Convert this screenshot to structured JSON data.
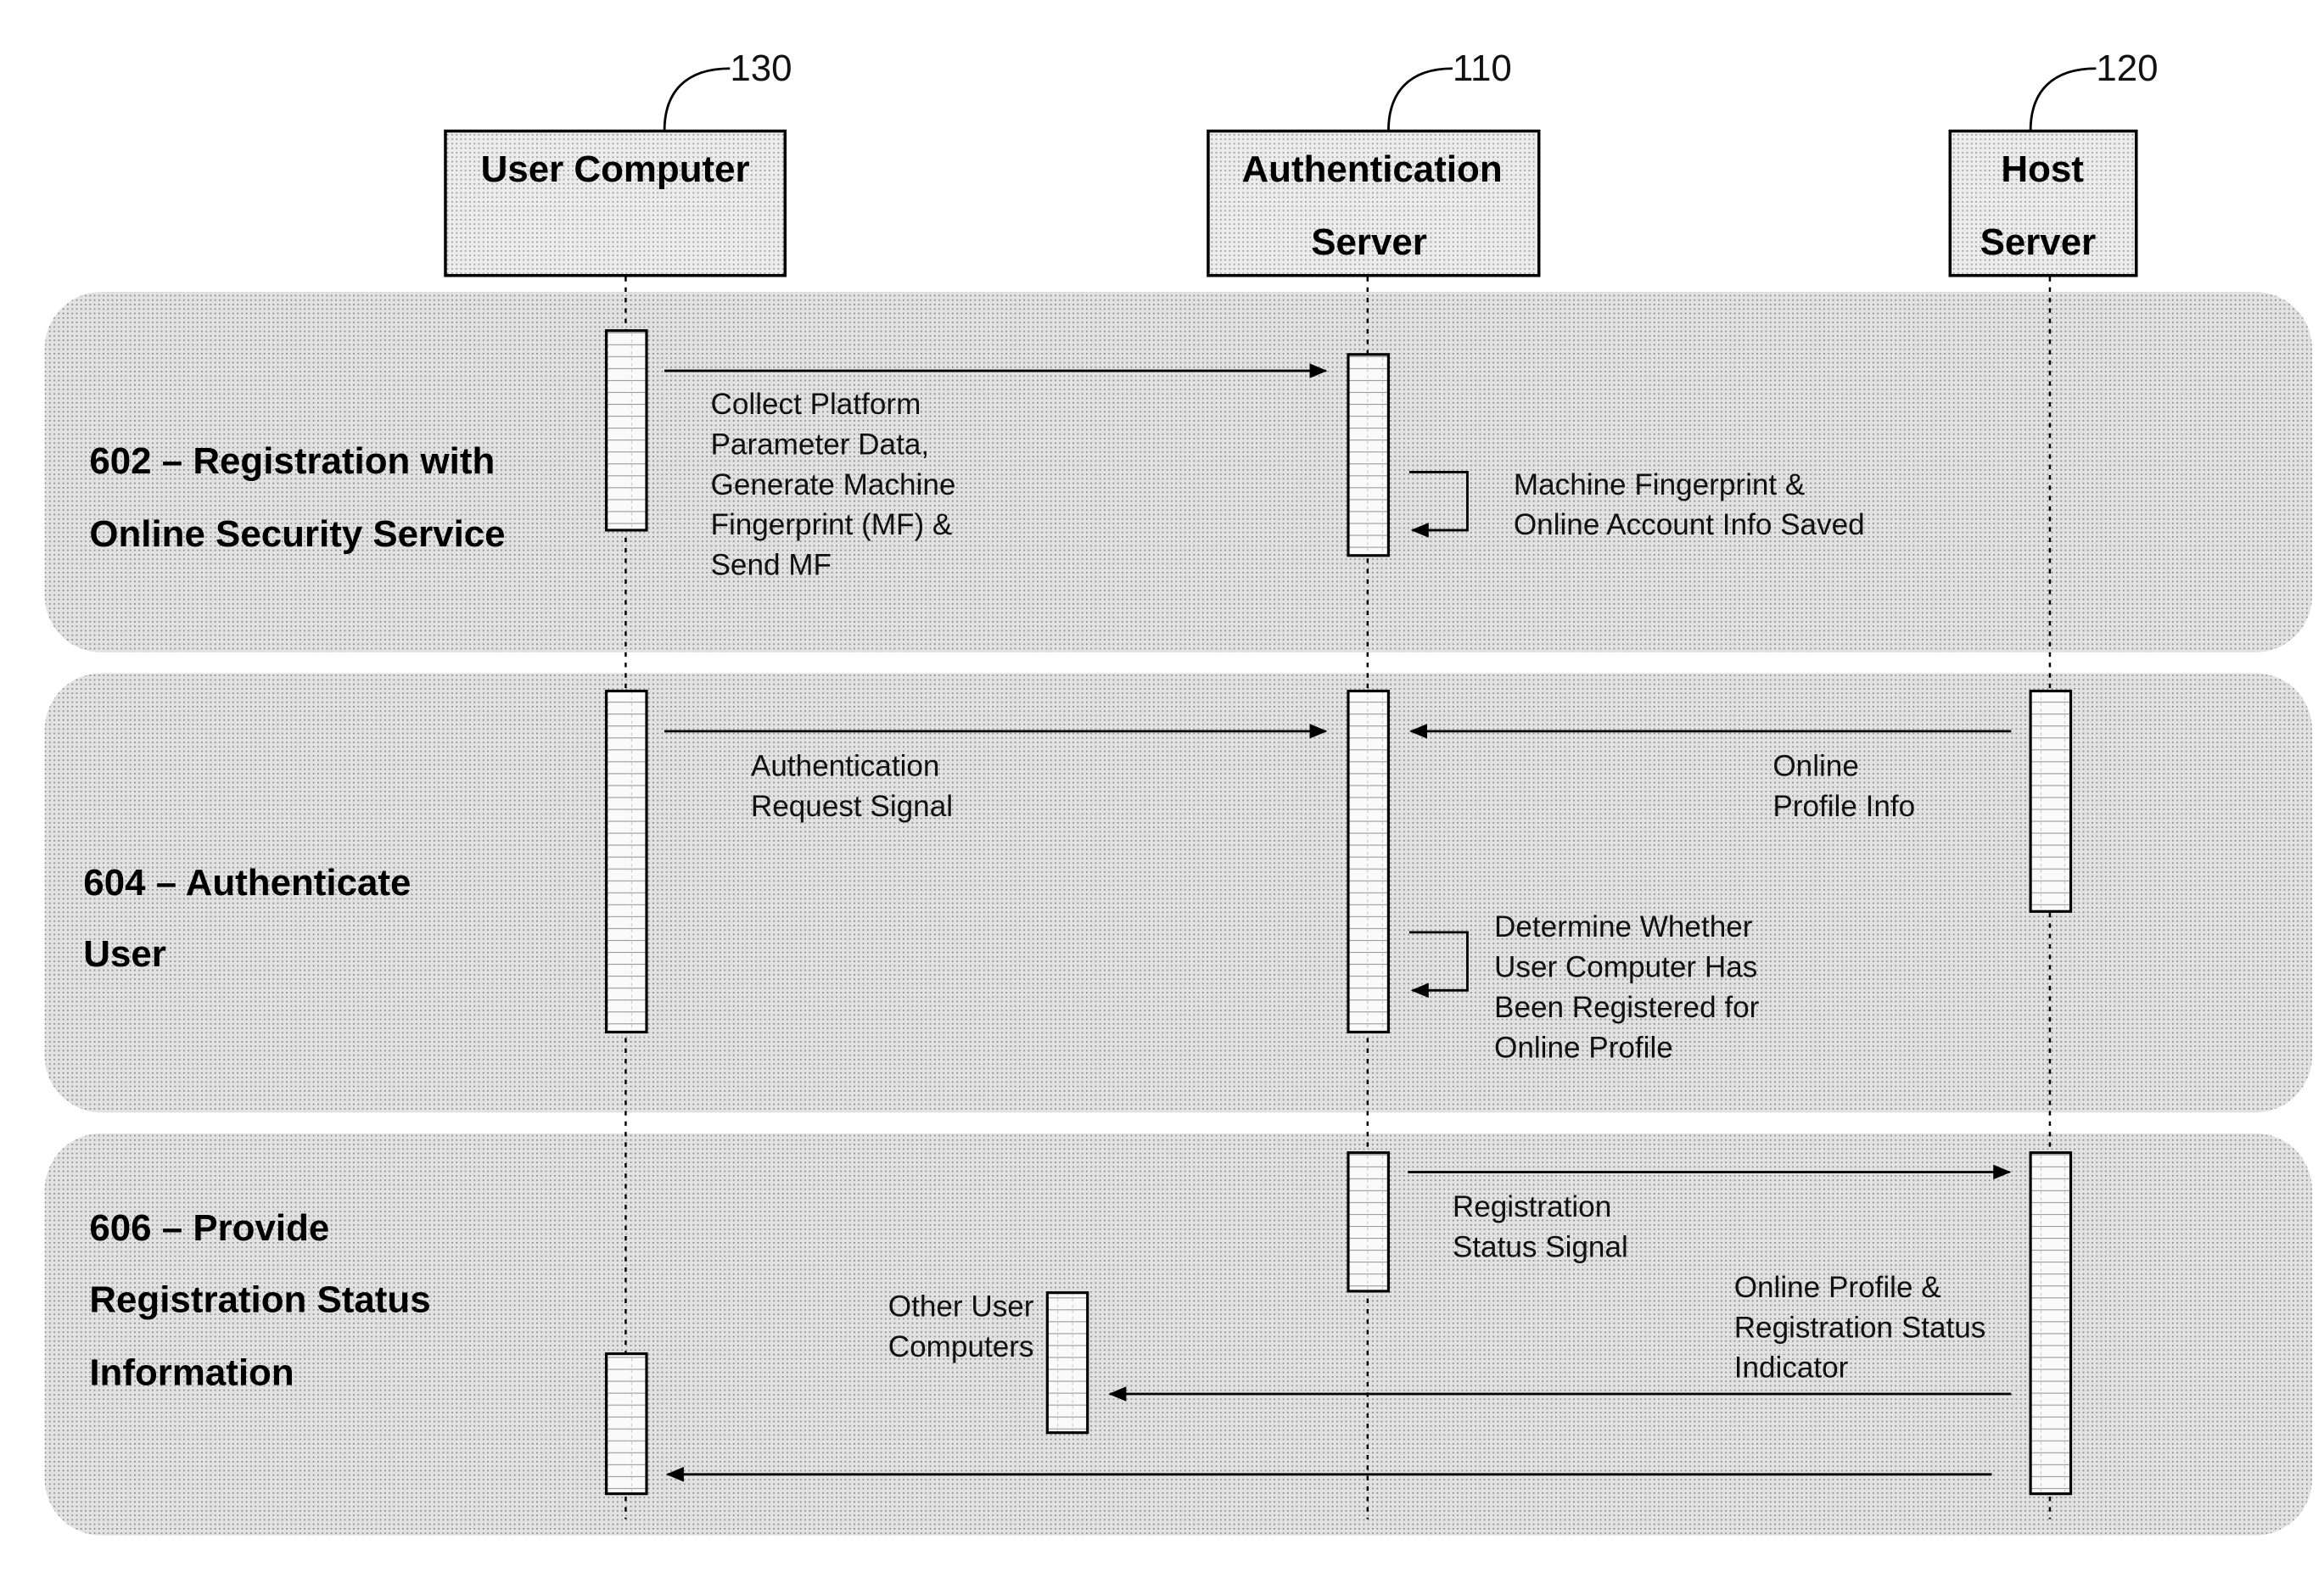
{
  "participants": [
    {
      "id": "user",
      "name_lines": [
        "User Computer"
      ],
      "ref": "130"
    },
    {
      "id": "auth",
      "name_lines": [
        "Authentication",
        "Server"
      ],
      "ref": "110"
    },
    {
      "id": "host",
      "name_lines": [
        "Host",
        "Server"
      ],
      "ref": "120"
    }
  ],
  "lanes": [
    {
      "id": "602",
      "title_lines": [
        "602 – Registration with",
        "Online Security Service"
      ]
    },
    {
      "id": "604",
      "title_lines": [
        "604 – Authenticate",
        "User"
      ]
    },
    {
      "id": "606",
      "title_lines": [
        "606 – Provide",
        "Registration Status",
        "Information"
      ]
    }
  ],
  "messages": {
    "collect": [
      "Collect Platform",
      "Parameter Data,",
      "Generate Machine",
      "Fingerprint (MF) &",
      "Send MF"
    ],
    "saved": [
      "Machine Fingerprint &",
      "Online Account Info Saved"
    ],
    "auth_request": [
      "Authentication",
      "Request Signal"
    ],
    "profile_info": [
      "Online",
      "Profile Info"
    ],
    "determine": [
      "Determine Whether",
      "User Computer Has",
      "Been Registered for",
      "Online Profile"
    ],
    "reg_status_signal": [
      "Registration",
      "Status Signal"
    ],
    "profile_indicator": [
      "Online Profile &",
      "Registration Status",
      "Indicator"
    ],
    "other_users": [
      "Other User",
      "Computers"
    ]
  },
  "colors": {
    "lane_fill": "#e4e4e4",
    "box_fill": "#ececec",
    "line": "#000000"
  }
}
